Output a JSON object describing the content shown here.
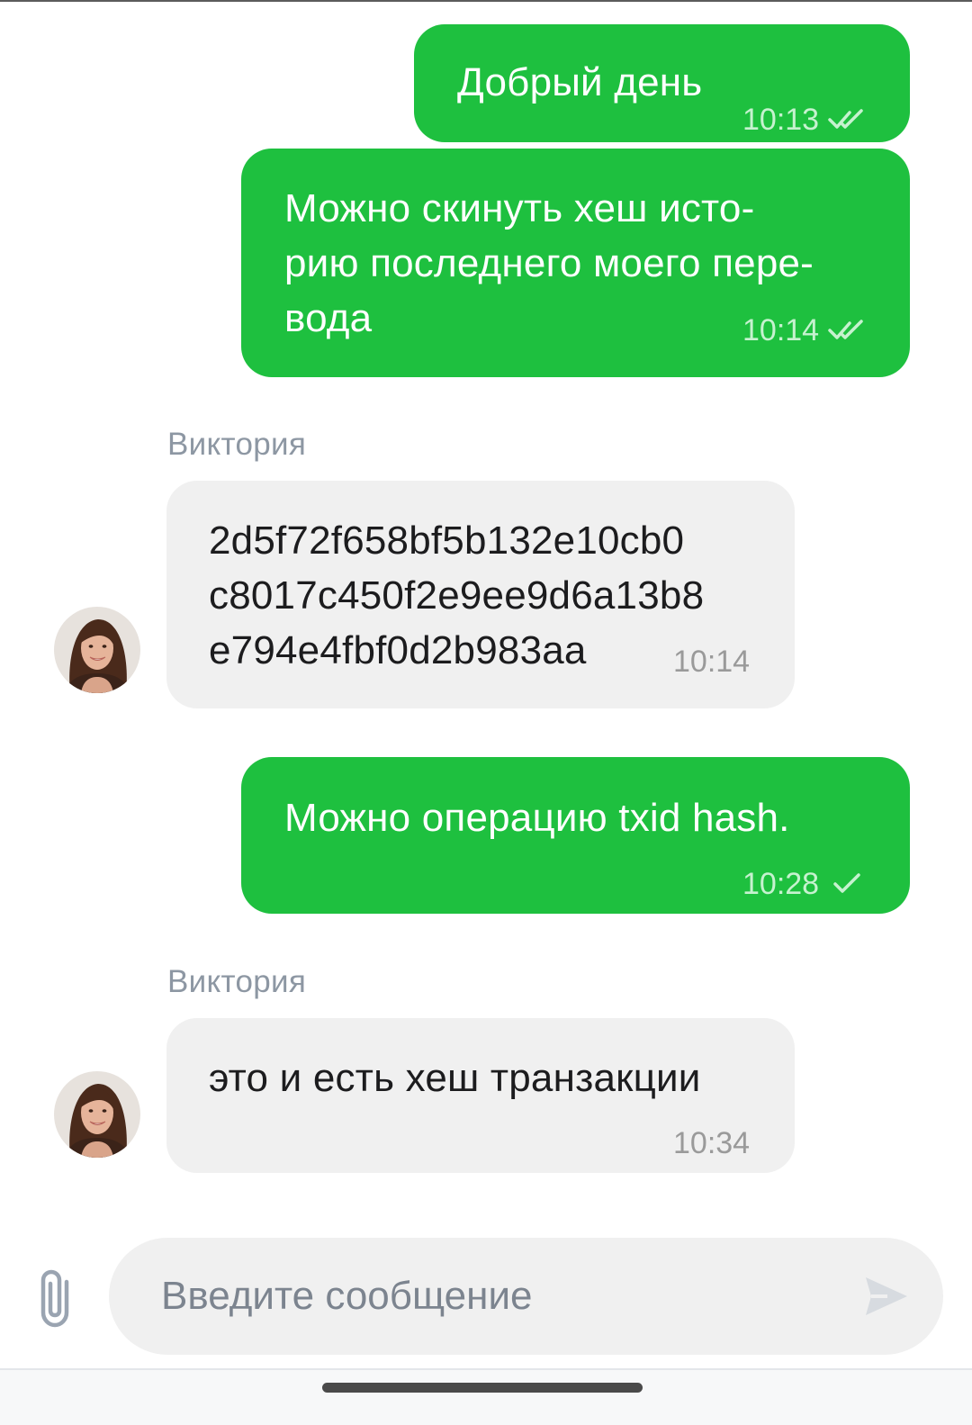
{
  "colors": {
    "outgoing_bubble": "#1ec03f",
    "incoming_bubble": "#f0f0f0",
    "sender_name": "#8d97a3"
  },
  "messages": [
    {
      "direction": "outgoing",
      "lines": [
        "Добрый день"
      ],
      "time": "10:13",
      "status": "read"
    },
    {
      "direction": "outgoing",
      "lines": [
        "Можно скинуть хеш исто-",
        "рию последнего моего пере-",
        "вода"
      ],
      "time": "10:14",
      "status": "read"
    },
    {
      "direction": "incoming",
      "sender": "Виктория",
      "lines": [
        "2d5f72f658bf5b132e10cb0",
        "c8017c450f2e9ee9d6a13b8",
        "e794e4fbf0d2b983aa"
      ],
      "time": "10:14"
    },
    {
      "direction": "outgoing",
      "lines": [
        "Можно операцию txid hash."
      ],
      "time": "10:28",
      "status": "sent"
    },
    {
      "direction": "incoming",
      "sender": "Виктория",
      "lines": [
        "это и есть хеш транзакции"
      ],
      "time": "10:34"
    }
  ],
  "composer": {
    "placeholder": "Введите сообщение",
    "value": "",
    "attach_icon": "paperclip-icon",
    "send_icon": "send-icon"
  }
}
